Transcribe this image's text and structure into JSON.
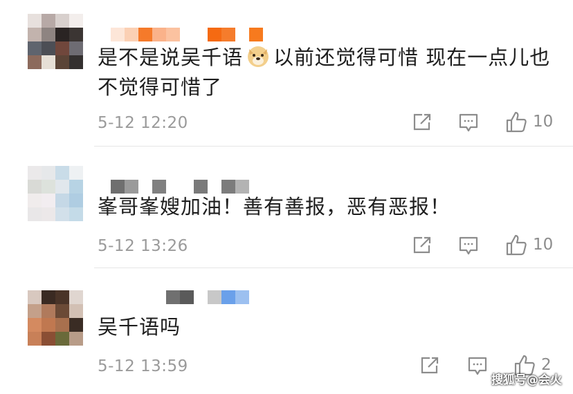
{
  "comments": [
    {
      "text_part1": "是不是说吴千语",
      "emoji": "doge",
      "text_part2": "以前还觉得可惜 现在一点儿也不觉得可惜了",
      "time": "5-12 12:20",
      "likes": "10"
    },
    {
      "text": "峯哥峯嫂加油！善有善报，恶有恶报！",
      "time": "5-12 13:26",
      "likes": "10"
    },
    {
      "text": "吴千语吗",
      "time": "5-12 13:59",
      "likes": "2"
    }
  ],
  "watermark": "搜狐号@会火",
  "icons": [
    "share-icon",
    "comment-icon",
    "like-icon"
  ]
}
